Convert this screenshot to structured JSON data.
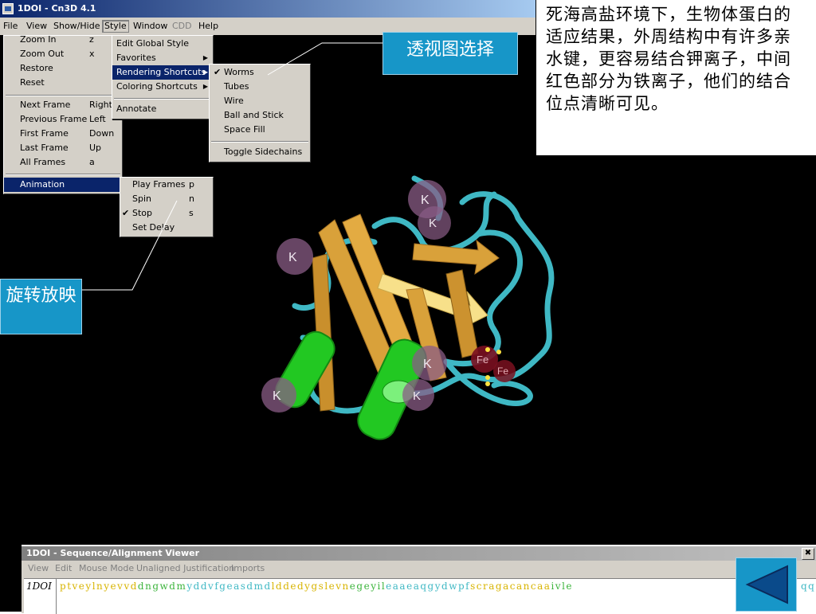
{
  "window": {
    "title": "1DOI - Cn3D 4.1"
  },
  "menubar": [
    {
      "label": "File",
      "state": "normal"
    },
    {
      "label": "View",
      "state": "normal"
    },
    {
      "label": "Show/Hide",
      "state": "normal"
    },
    {
      "label": "Style",
      "state": "open"
    },
    {
      "label": "Window",
      "state": "normal"
    },
    {
      "label": "CDD",
      "state": "disabled"
    },
    {
      "label": "Help",
      "state": "normal"
    }
  ],
  "view_menu": {
    "items": [
      {
        "label": "Zoom In",
        "key": "z"
      },
      {
        "label": "Zoom Out",
        "key": "x"
      },
      {
        "label": "Restore",
        "key": ""
      },
      {
        "label": "Reset",
        "key": ""
      },
      {
        "label": "Next Frame",
        "key": "Right"
      },
      {
        "label": "Previous Frame",
        "key": "Left"
      },
      {
        "label": "First Frame",
        "key": "Down"
      },
      {
        "label": "Last Frame",
        "key": "Up"
      },
      {
        "label": "All Frames",
        "key": "a"
      },
      {
        "label": "Animation",
        "key": ""
      }
    ]
  },
  "style_menu": {
    "items": [
      {
        "label": "Edit Global Style"
      },
      {
        "label": "Favorites"
      },
      {
        "label": "Rendering Shortcuts"
      },
      {
        "label": "Coloring Shortcuts"
      },
      {
        "label": "Annotate"
      }
    ]
  },
  "rendering_menu": {
    "items": [
      {
        "label": "Worms",
        "checked": true
      },
      {
        "label": "Tubes",
        "checked": false
      },
      {
        "label": "Wire",
        "checked": false
      },
      {
        "label": "Ball and Stick",
        "checked": false
      },
      {
        "label": "Space Fill",
        "checked": false
      },
      {
        "label": "Toggle Sidechains",
        "checked": false
      }
    ]
  },
  "animation_menu": {
    "items": [
      {
        "label": "Play Frames",
        "key": "p",
        "checked": false
      },
      {
        "label": "Spin",
        "key": "n",
        "checked": false
      },
      {
        "label": "Stop",
        "key": "s",
        "checked": true
      },
      {
        "label": "Set Delay",
        "key": "",
        "checked": false
      }
    ]
  },
  "callouts": {
    "perspective": "透视图选择",
    "rotate": "旋转放映"
  },
  "description": "死海高盐环境下，生物体蛋白的适应结果，外周结构中有许多亲水键，更容易结合钾离子，中间红色部分为铁离子，他们的结合位点清晰可见。",
  "molecule_labels": {
    "potassium": "K",
    "iron": "Fe"
  },
  "sequence_viewer": {
    "title": "1DOI - Sequence/Alignment Viewer",
    "menu": [
      "View",
      "Edit",
      "Mouse Mode",
      "Unaligned Justification",
      "Imports"
    ],
    "row_name": "1DOI",
    "sequence": "ptveylnyevvddngwdmyddvfgeasdmdlddedygslevnegeyileaaeaqgydwpfscragacancaaivle",
    "tail": "qq"
  },
  "colors": {
    "callout_bg": "#1796c8",
    "helix": "#22c822",
    "strand": "#d9a13a",
    "coil": "#3fb8c4",
    "potassium": "#8a5c86",
    "iron": "#7a1020"
  }
}
